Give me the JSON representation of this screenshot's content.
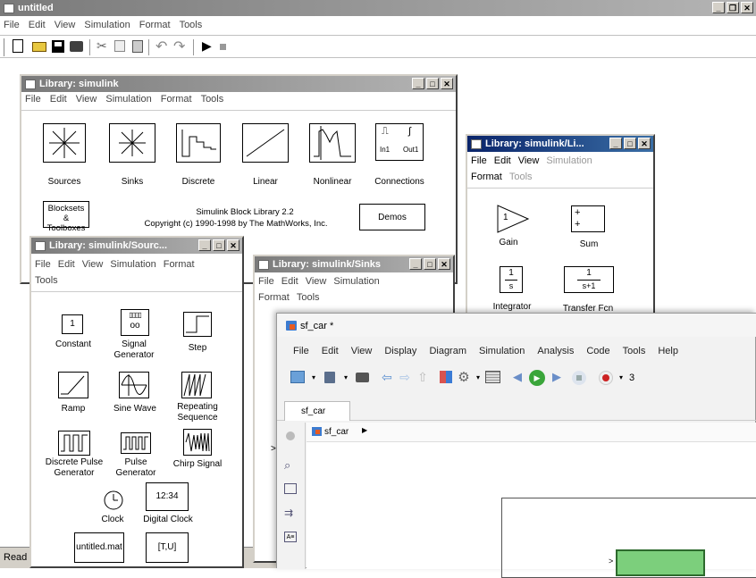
{
  "main": {
    "title": "untitled",
    "menu": [
      "File",
      "Edit",
      "View",
      "Simulation",
      "Format",
      "Tools"
    ],
    "status": "Read"
  },
  "lib_simulink": {
    "title": "Library: simulink",
    "menu": [
      "File",
      "Edit",
      "View",
      "Simulation",
      "Format",
      "Tools"
    ],
    "blocks": [
      "Sources",
      "Sinks",
      "Discrete",
      "Linear",
      "Nonlinear",
      "Connections"
    ],
    "conn_in": "In1",
    "conn_out": "Out1",
    "blocksets_label": "Blocksets & Toolboxes",
    "version": "Simulink Block Library 2.2",
    "copyright": "Copyright (c) 1990-1998 by The MathWorks, Inc.",
    "demos": "Demos"
  },
  "lib_linear": {
    "title": "Library: simulink/Li...",
    "menu": [
      "File",
      "Edit",
      "View",
      "Simulation",
      "Format",
      "Tools"
    ],
    "gain_label": "Gain",
    "gain_value": "1",
    "sum_label": "Sum",
    "integrator_label": "Integrator",
    "integrator_num": "1",
    "integrator_den": "s",
    "tf_label": "Transfer Fcn",
    "tf_num": "1",
    "tf_den": "s+1"
  },
  "lib_sources": {
    "title": "Library: simulink/Sourc...",
    "menu": [
      "File",
      "Edit",
      "View",
      "Simulation",
      "Format",
      "Tools"
    ],
    "constant_value": "1",
    "constant": "Constant",
    "signal_generator": "Signal Generator",
    "step": "Step",
    "ramp": "Ramp",
    "sine_wave": "Sine Wave",
    "repeating_sequence": "Repeating Sequence",
    "discrete_pulse": "Discrete Pulse Generator",
    "pulse": "Pulse Generator",
    "chirp": "Chirp Signal",
    "clock": "Clock",
    "digital_clock_value": "12:34",
    "digital_clock": "Digital Clock",
    "fromfile_value": "untitled.mat",
    "fromws_value": "[T,U]"
  },
  "lib_sinks": {
    "title": "Library: simulink/Sinks",
    "menu": [
      "File",
      "Edit",
      "View",
      "Simulation",
      "Format",
      "Tools"
    ]
  },
  "sf_car": {
    "title": "sf_car *",
    "menu": [
      "File",
      "Edit",
      "View",
      "Display",
      "Diagram",
      "Simulation",
      "Analysis",
      "Code",
      "Tools",
      "Help"
    ],
    "tab": "sf_car",
    "breadcrumb": "sf_car",
    "zoom_partial": "3"
  },
  "colors": {
    "active_title": "#0a246a",
    "inactive_title": "#808080",
    "chrome": "#d4d0c8",
    "run_green": "#3aa53a",
    "record_red": "#cc2222",
    "block_green": "#7ccf7c"
  }
}
